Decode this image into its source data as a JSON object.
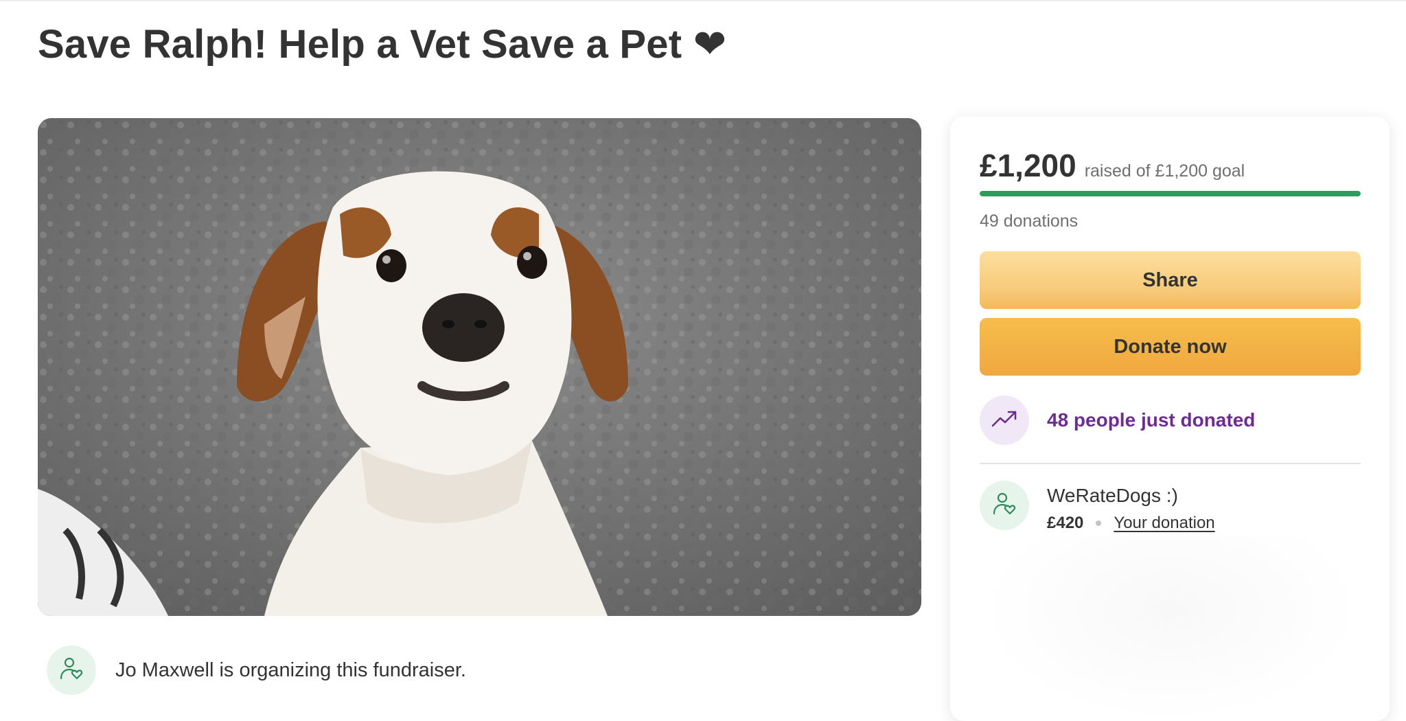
{
  "campaign": {
    "title": "Save Ralph! Help a Vet Save a Pet ❤"
  },
  "organizer": {
    "text": "Jo Maxwell is organizing this fundraiser."
  },
  "donation_card": {
    "amount_raised": "£1,200",
    "raised_label": "raised of £1,200 goal",
    "progress_fraction": 1.0,
    "donations_count": "49 donations",
    "share_label": "Share",
    "donate_label": "Donate now",
    "trend_text": "48 people just donated",
    "recent_donor": {
      "name": "WeRateDogs :)",
      "amount": "£420",
      "link_label": "Your donation"
    }
  },
  "colors": {
    "progress": "#2e9c5c",
    "share_button": "#f7c976",
    "donate_button": "#f0a83f",
    "trend_text": "#6b2d8f"
  },
  "icons": {
    "organizer": "person-heart-icon",
    "trend": "trending-up-icon",
    "donor": "person-heart-icon"
  }
}
